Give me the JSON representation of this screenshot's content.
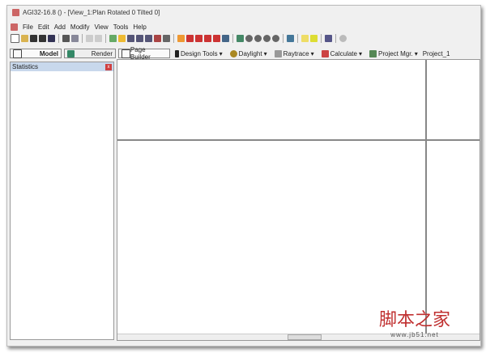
{
  "window": {
    "title": "AGI32-16.8 () - [View_1:Plan Rotated 0 Tilted 0]"
  },
  "menu": [
    "File",
    "Edit",
    "Add",
    "Modify",
    "View",
    "Tools",
    "Help"
  ],
  "tabs": {
    "model": "Model",
    "render": "Render",
    "page_builder": "Page Builder"
  },
  "tools": [
    "Design Tools",
    "Daylight",
    "Raytrace",
    "Calculate",
    "Project Mgr."
  ],
  "project": "Project_1",
  "panel": {
    "title": "Statistics",
    "close": "x"
  },
  "watermark": {
    "text": "脚本之家",
    "url": "www.jb51.net"
  }
}
